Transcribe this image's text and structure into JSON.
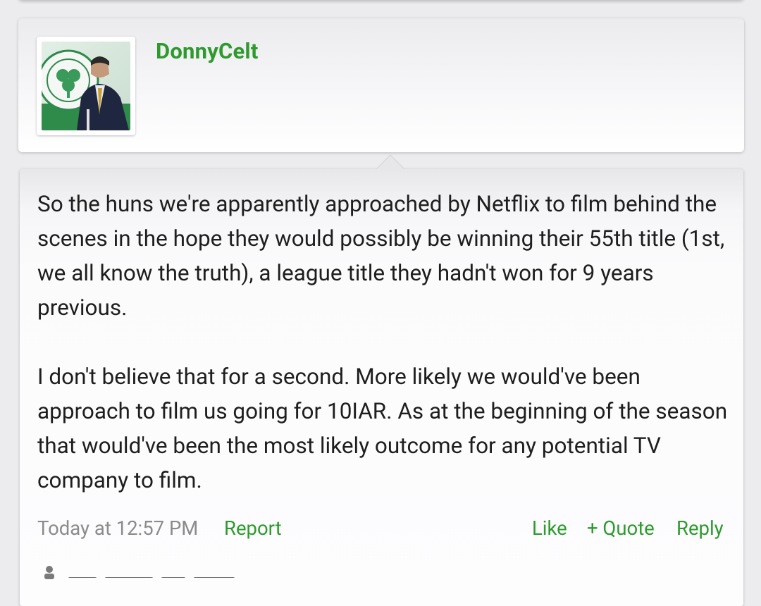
{
  "user": {
    "name": "DonnyCelt",
    "avatar_icon": "avatar-photo"
  },
  "post": {
    "paragraphs": [
      "So the huns we're apparently approached by Netflix to film behind the scenes in the hope they would possibly be winning their 55th title (1st, we all know the truth), a league title they hadn't won for 9 years previous.",
      "I don't believe that for a second. More likely we would've been approach to film us going for 10IAR. As at the beginning of the season that would've been the most likely outcome for any potential TV company to film."
    ],
    "timestamp": "Today at 12:57 PM",
    "actions": {
      "report": "Report",
      "like": "Like",
      "quote": "+ Quote",
      "reply": "Reply"
    }
  },
  "colors": {
    "accent": "#2e9a2e",
    "muted": "#8b8b8b",
    "text": "#1e1e1e",
    "background": "#ececee"
  }
}
